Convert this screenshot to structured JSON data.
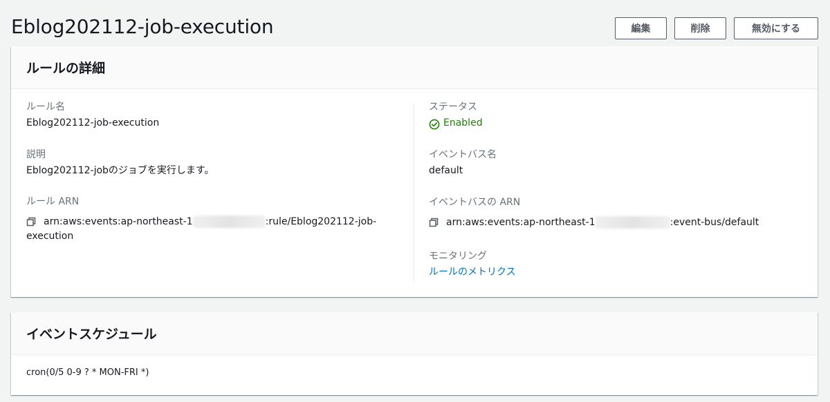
{
  "page": {
    "title": "Eblog202112-job-execution"
  },
  "actions": {
    "edit_label": "編集",
    "delete_label": "削除",
    "disable_label": "無効にする"
  },
  "details": {
    "title": "ルールの詳細",
    "rule_name_label": "ルール名",
    "rule_name_value": "Eblog202112-job-execution",
    "description_label": "説明",
    "description_value": "Eblog202112-jobのジョブを実行します。",
    "rule_arn_label": "ルール ARN",
    "rule_arn_prefix": "arn:aws:events:ap-northeast-1",
    "rule_arn_suffix_line1": ":rule/Eblog202112-job-",
    "rule_arn_suffix_line2": "execution",
    "status_label": "ステータス",
    "status_value": "Enabled",
    "event_bus_name_label": "イベントバス名",
    "event_bus_name_value": "default",
    "event_bus_arn_label": "イベントバスの ARN",
    "event_bus_arn_prefix": "arn:aws:events:ap-northeast-1",
    "event_bus_arn_suffix": ":event-bus/default",
    "monitoring_label": "モニタリング",
    "monitoring_link": "ルールのメトリクス"
  },
  "schedule": {
    "title": "イベントスケジュール",
    "cron_value": "cron(0/5 0-9 ? * MON-FRI *)"
  },
  "colors": {
    "status_green": "#1d8102",
    "link_blue": "#0073bb",
    "label_grey": "#687078",
    "button_border": "#545b64"
  },
  "icons": {
    "copy": "copy-icon",
    "status": "status-check-icon"
  }
}
